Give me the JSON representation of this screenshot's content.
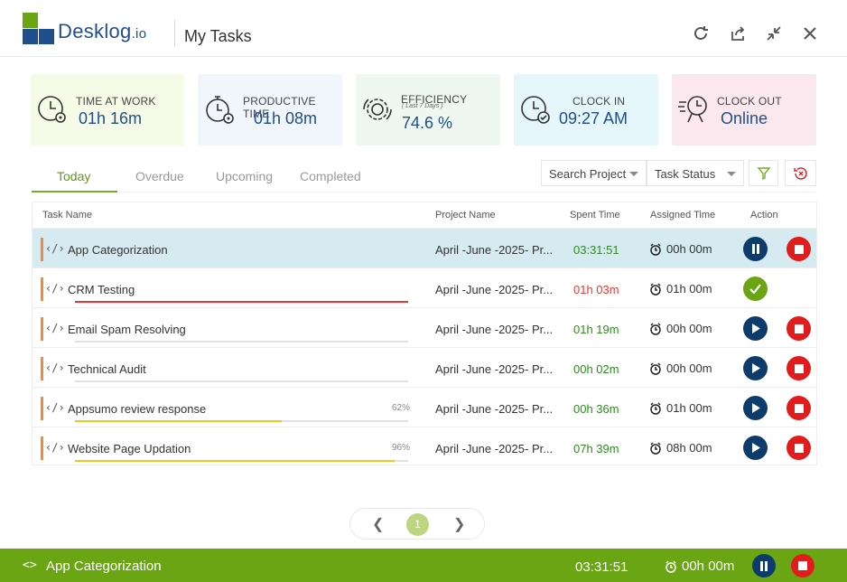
{
  "app": {
    "logo_text": "Desklog",
    "logo_suffix": ".io",
    "title": "My Tasks"
  },
  "header_icons": [
    "refresh-icon",
    "export-icon",
    "collapse-icon",
    "close-icon"
  ],
  "stats": [
    {
      "label": "TIME AT WORK",
      "value": "01h 16m",
      "icon": "clock-gear-icon"
    },
    {
      "label": "PRODUCTIVE TIME",
      "value": "01h 08m",
      "icon": "stopwatch-gear-icon"
    },
    {
      "label": "EFFICIENCY",
      "sublabel": "( Last 7 Days )",
      "value": "74.6 %",
      "icon": "efficiency-gear-icon"
    },
    {
      "label": "CLOCK IN",
      "value": "09:27 AM",
      "icon": "clock-check-icon"
    },
    {
      "label": "CLOCK OUT",
      "value": "Online",
      "icon": "running-clock-icon"
    }
  ],
  "tabs": [
    "Today",
    "Overdue",
    "Upcoming",
    "Completed"
  ],
  "filters": {
    "project": "Search Project",
    "status": "Task Status"
  },
  "columns": [
    "Task Name",
    "Project Name",
    "Spent Time",
    "Assigned Time",
    "Action"
  ],
  "tasks": [
    {
      "name": "App Categorization",
      "project": "April -June -2025- Pr...",
      "spent": "03:31:51",
      "assigned": "00h 00m",
      "state": "running"
    },
    {
      "name": "CRM Testing",
      "project": "April -June -2025- Pr...",
      "spent": "01h 03m",
      "assigned": "01h 00m",
      "state": "done",
      "overdue": true
    },
    {
      "name": "Email Spam Resolving",
      "project": "April -June -2025- Pr...",
      "spent": "01h 19m",
      "assigned": "00h 00m",
      "state": "idle"
    },
    {
      "name": "Technical Audit",
      "project": "April -June -2025- Pr...",
      "spent": "00h 02m",
      "assigned": "00h 00m",
      "state": "idle"
    },
    {
      "name": "Appsumo review response",
      "project": "April -June -2025- Pr...",
      "spent": "00h 36m",
      "assigned": "01h 00m",
      "state": "idle",
      "progress_label": "62%",
      "progress": 0.62
    },
    {
      "name": "Website  Page Updation",
      "project": "April -June -2025- Pr...",
      "spent": "07h 39m",
      "assigned": "08h 00m",
      "state": "idle",
      "progress_label": "96%",
      "progress": 0.96
    }
  ],
  "pagination": {
    "current": "1"
  },
  "footer": {
    "task": "App Categorization",
    "time": "03:31:51",
    "assigned": "00h 00m"
  },
  "colors": {
    "brand_green": "#6aa514",
    "navy": "#0d3b6b",
    "stop_red": "#e21b1b",
    "overdue_red": "#e53935",
    "progress_yellow": "#f5c518",
    "bar_orange": "#f08a3c"
  }
}
